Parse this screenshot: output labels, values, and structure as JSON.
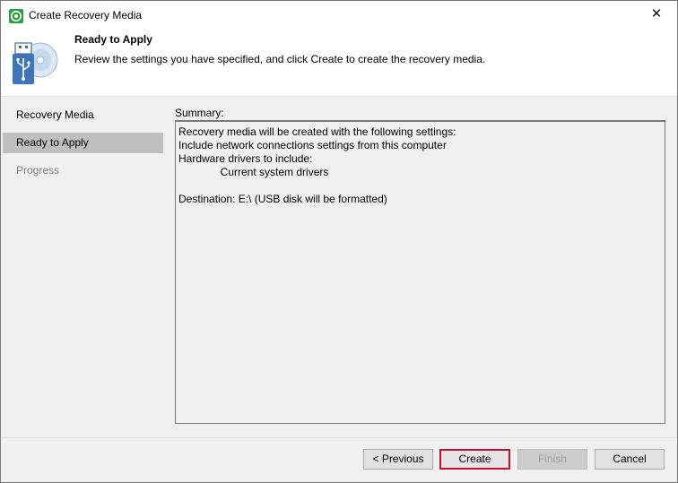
{
  "window": {
    "title": "Create Recovery Media",
    "close_glyph": "✕"
  },
  "header": {
    "title": "Ready to Apply",
    "description": "Review the settings you have specified, and click Create to create the recovery media."
  },
  "sidebar": {
    "items": [
      {
        "label": "Recovery Media",
        "state": "normal"
      },
      {
        "label": "Ready to Apply",
        "state": "selected"
      },
      {
        "label": "Progress",
        "state": "disabled"
      }
    ]
  },
  "summary": {
    "label": "Summary:",
    "lines": [
      "Recovery media will be created with the following settings:",
      "Include network connections settings from this computer",
      "Hardware drivers to include:",
      "              Current system drivers",
      "",
      "Destination: E:\\ (USB disk will be formatted)"
    ]
  },
  "buttons": {
    "previous": "< Previous",
    "create": "Create",
    "finish": "Finish",
    "cancel": "Cancel"
  },
  "colors": {
    "accent_border": "#c8102e",
    "selected_item": "#bfbfbf",
    "app_icon": "#2e9e44"
  }
}
